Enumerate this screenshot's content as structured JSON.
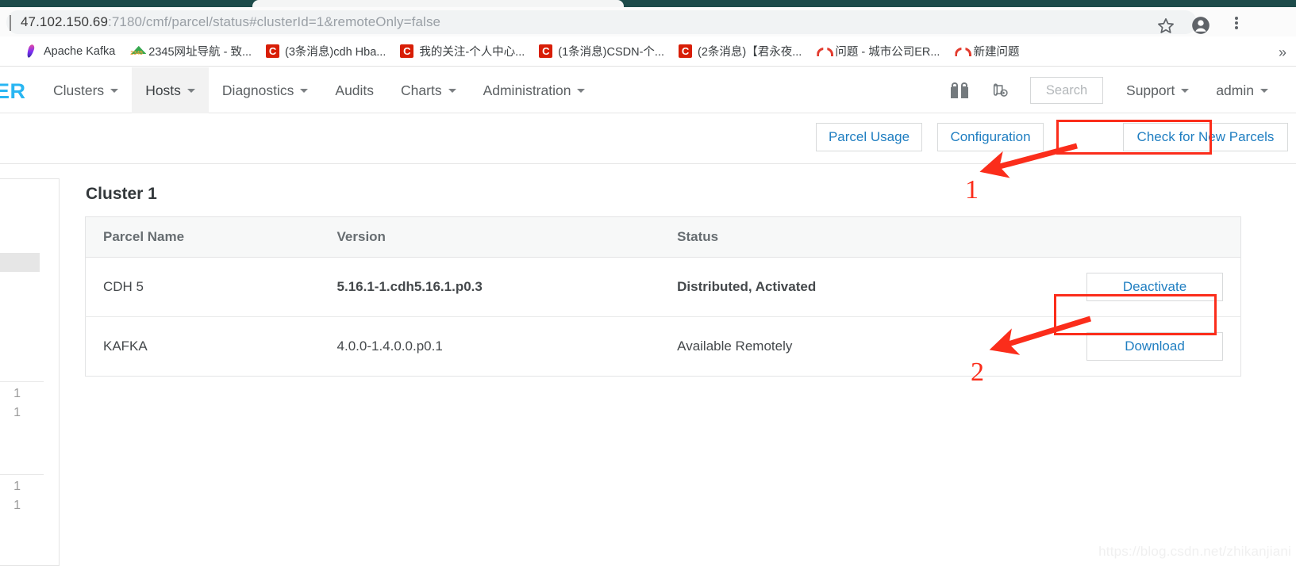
{
  "browser": {
    "url_host": "47.102.150.69",
    "url_rest": ":7180/cmf/parcel/status#clusterId=1&remoteOnly=false",
    "star_icon": "star-icon",
    "profile_icon": "profile-avatar-icon",
    "menu_icon": "kebab-menu-icon",
    "overflow_label": "»",
    "bookmarks": [
      {
        "label": "Apache Kafka",
        "favicon": "kafka-icon"
      },
      {
        "label": "2345网址导航 - 致...",
        "favicon": "2345-icon"
      },
      {
        "label": "(3条消息)cdh Hba...",
        "favicon": "csdn-icon"
      },
      {
        "label": "我的关注-个人中心...",
        "favicon": "csdn-icon"
      },
      {
        "label": "(1条消息)CSDN-个...",
        "favicon": "csdn-icon"
      },
      {
        "label": "(2条消息)【君永夜...",
        "favicon": "csdn-icon"
      },
      {
        "label": "问题 - 城市公司ER...",
        "favicon": "arc-icon"
      },
      {
        "label": "新建问题",
        "favicon": "arc-icon"
      }
    ]
  },
  "cm_nav": {
    "logo": "ER",
    "items": [
      {
        "label": "Clusters",
        "caret": true,
        "active": false
      },
      {
        "label": "Hosts",
        "caret": true,
        "active": true
      },
      {
        "label": "Diagnostics",
        "caret": true,
        "active": false
      },
      {
        "label": "Audits",
        "caret": false,
        "active": false
      },
      {
        "label": "Charts",
        "caret": true,
        "active": false
      },
      {
        "label": "Administration",
        "caret": true,
        "active": false
      }
    ],
    "gift_icon": "gift-icon",
    "scroll_icon": "scroll-play-icon",
    "search_placeholder": "Search",
    "support_label": "Support",
    "user_label": "admin"
  },
  "toolbar": {
    "parcel_usage_label": "Parcel Usage",
    "configuration_label": "Configuration",
    "check_new_parcels_label": "Check for New Parcels"
  },
  "left_panel": {
    "counts": [
      "1",
      "1",
      "1",
      "1"
    ]
  },
  "main": {
    "cluster_title": "Cluster 1",
    "columns": [
      "Parcel Name",
      "Version",
      "Status",
      ""
    ],
    "rows": [
      {
        "name": "CDH 5",
        "version": "5.16.1-1.cdh5.16.1.p0.3",
        "version_style": "bold",
        "status": "Distributed, Activated",
        "status_style": "bold",
        "action": "Deactivate"
      },
      {
        "name": "KAFKA",
        "version": "4.0.0-1.4.0.0.p0.1",
        "version_style": "dim",
        "status": "Available Remotely",
        "status_style": "dim",
        "action": "Download"
      }
    ]
  },
  "annotations": {
    "accent_color": "#fb2d1b",
    "marker_one": "1",
    "marker_two": "2"
  },
  "watermark": "https://blog.csdn.net/zhikanjiani"
}
